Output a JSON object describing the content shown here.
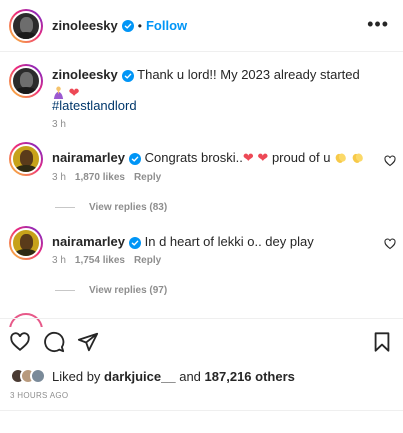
{
  "header": {
    "username": "zinoleesky",
    "separator": "•",
    "follow_label": "Follow",
    "more_label": "•••"
  },
  "caption": {
    "username": "zinoleesky",
    "text": "Thank u lord!! My 2023 already started",
    "emojis": [
      "praying-woman-emoji",
      "red-heart-emoji"
    ],
    "hashtag": "#latestlandlord",
    "time": "3 h"
  },
  "comments": [
    {
      "username": "nairamarley",
      "text_before": "Congrats broski..",
      "text_after": " proud of u",
      "time": "3 h",
      "likes": "1,870 likes",
      "reply_label": "Reply",
      "view_replies": "View replies (83)"
    },
    {
      "username": "nairamarley",
      "text": "In d heart of lekki o.. dey play",
      "time": "3 h",
      "likes": "1,754 likes",
      "reply_label": "Reply",
      "view_replies": "View replies (97)"
    }
  ],
  "likes": {
    "prefix": "Liked by",
    "user": "darkjuice__",
    "connector": "and",
    "count": "187,216 others"
  },
  "timestamp": "3 HOURS AGO",
  "colors": {
    "accent": "#0095f6",
    "verified": "#0095f6",
    "heart": "#ed4956",
    "hashtag": "#00376b",
    "muted": "#8e8e8e"
  },
  "icons": [
    "verified-badge-icon",
    "more-options-icon",
    "heart-icon",
    "comment-icon",
    "share-icon",
    "bookmark-icon"
  ]
}
